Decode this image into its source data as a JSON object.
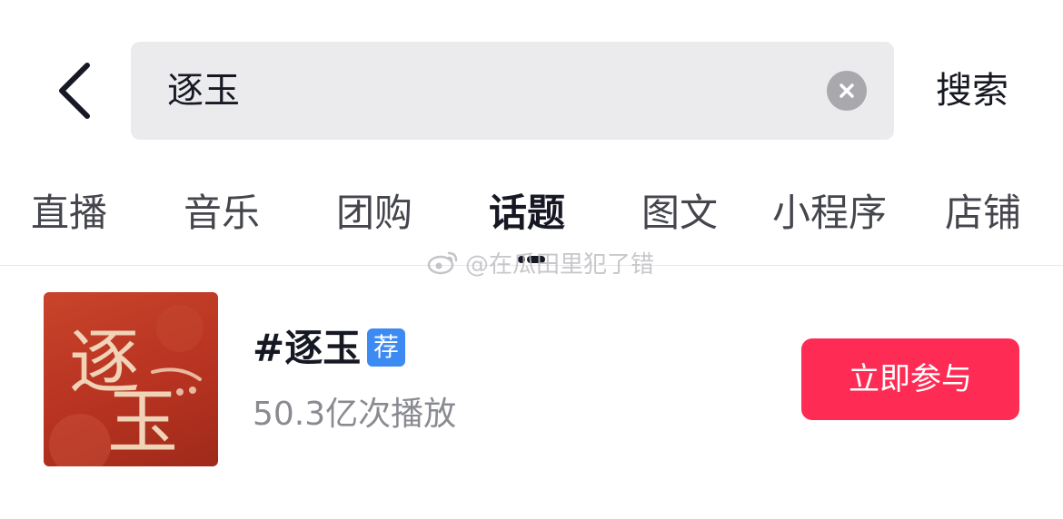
{
  "header": {
    "back_icon": "chevron-left-icon",
    "search": {
      "value": "逐玉",
      "clear_icon": "clear-icon"
    },
    "search_button_label": "搜索"
  },
  "tabs": [
    {
      "label": "直播",
      "active": false
    },
    {
      "label": "音乐",
      "active": false
    },
    {
      "label": "团购",
      "active": false
    },
    {
      "label": "话题",
      "active": true
    },
    {
      "label": "图文",
      "active": false
    },
    {
      "label": "小程序",
      "active": false
    },
    {
      "label": "店铺",
      "active": false
    }
  ],
  "watermark": {
    "text": "@在瓜田里犯了错",
    "icon": "weibo-icon"
  },
  "topic": {
    "title": "#逐玉",
    "badge": "荐",
    "meta": "50.3亿次播放",
    "join_button_label": "立即参与",
    "cover_text": "逐玉"
  },
  "colors": {
    "accent": "#fe2c55",
    "badge": "#3d8bf2",
    "search_bg": "#ebebed",
    "cover_red": "#b83321"
  }
}
